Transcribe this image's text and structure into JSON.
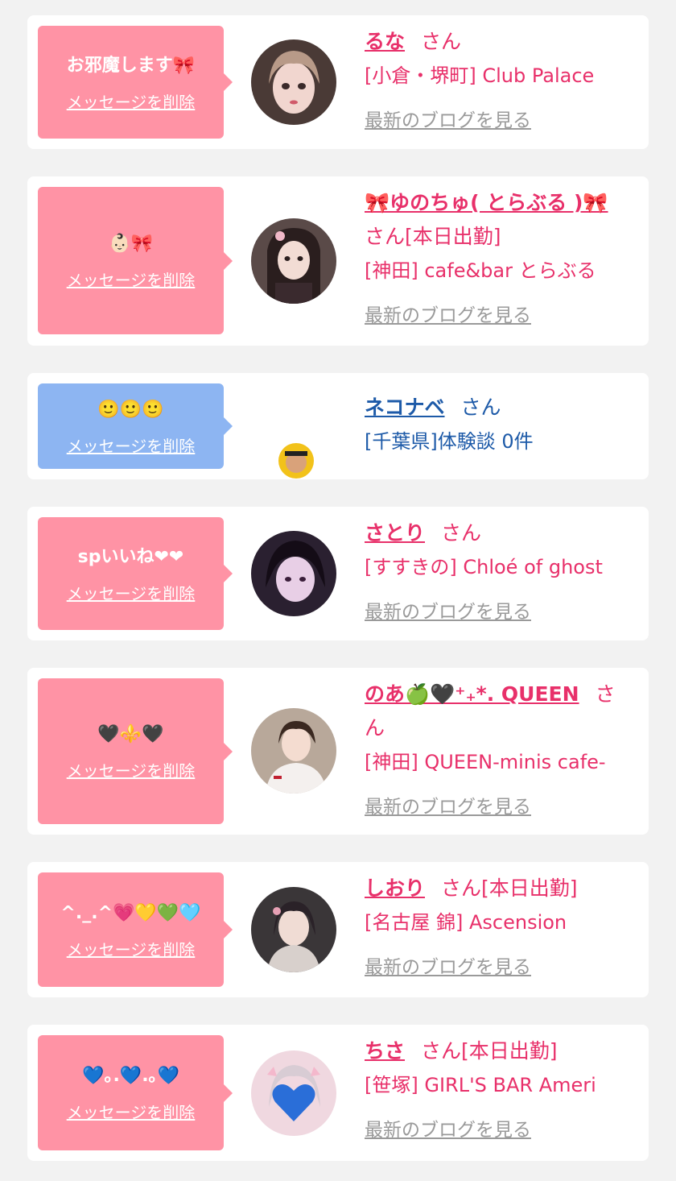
{
  "delete_label": "メッセージを削除",
  "blog_label": "最新のブログを見る",
  "san_label": "さん",
  "colors": {
    "bubble_pink": "#ff93a5",
    "bubble_blue": "#8db5f2",
    "name_pink": "#e8306a",
    "name_blue": "#1d5aa8",
    "blog_gray": "#9a9a9a"
  },
  "cards": [
    {
      "message": "お邪魔します🎀",
      "name": "るな",
      "status": "",
      "shop": "[小倉・堺町] Club Palace",
      "blog": true
    },
    {
      "message": "👶🏻🎀",
      "name": "🎀ゆのちゅ( とらぶる )🎀",
      "status": "[本日出勤]",
      "shop": "[神田] cafe&bar とらぶる",
      "blog": true
    },
    {
      "message": "🙂🙂🙂",
      "name": "ネコナベ",
      "status": "",
      "shop": "[千葉県]体験談 0件",
      "blog": false
    },
    {
      "message": "spいいね❤❤",
      "name": "さとり",
      "status": "",
      "shop": "[すすきの] Chloé of ghost",
      "blog": true
    },
    {
      "message": "🖤⚜️🖤",
      "name": "のあ🍏🖤⁺₊*. QUEEN",
      "status": "",
      "shop": "[神田] QUEEN-minis cafe-",
      "blog": true
    },
    {
      "message": "^._.^💗💛💚🩵",
      "name": "しおり",
      "status": "[本日出勤]",
      "shop": "[名古屋 錦] Ascension",
      "blog": true
    },
    {
      "message": "💙｡.💙.｡💙",
      "name": "ちさ",
      "status": "[本日出勤]",
      "shop": "[笹塚] GIRL'S BAR Ameri",
      "blog": true
    }
  ]
}
